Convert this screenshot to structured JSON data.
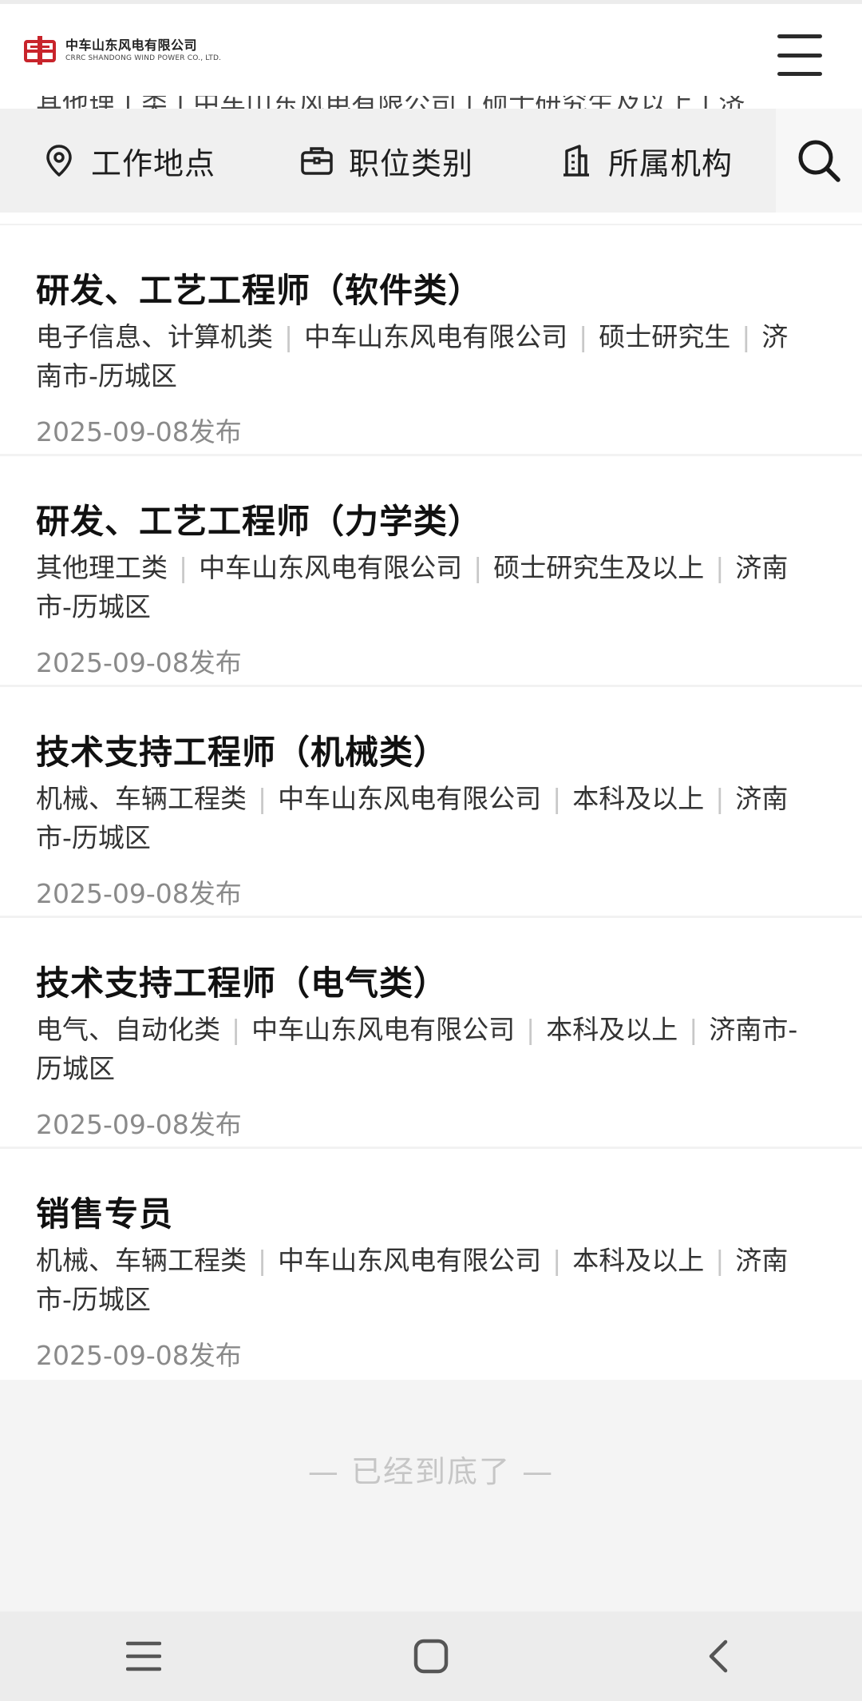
{
  "header": {
    "logo_cn": "中车山东风电有限公司",
    "logo_en": "CRRC SHANDONG WIND POWER CO., LTD."
  },
  "peek_text": "其他理工类  |  中车山东风电有限公司  |  硕士研究生及以上  |  济",
  "filters": [
    {
      "label": "工作地点",
      "icon": "location-pin-icon"
    },
    {
      "label": "职位类别",
      "icon": "briefcase-icon"
    },
    {
      "label": "所属机构",
      "icon": "building-icon"
    }
  ],
  "jobs": [
    {
      "title": "研发、工艺工程师（软件类）",
      "category": "电子信息、计算机类",
      "company": "中车山东风电有限公司",
      "education": "硕士研究生",
      "location": "济南市-历城区",
      "date": "2025-09-08发布"
    },
    {
      "title": "研发、工艺工程师（力学类）",
      "category": "其他理工类",
      "company": "中车山东风电有限公司",
      "education": "硕士研究生及以上",
      "location": "济南市-历城区",
      "date": "2025-09-08发布"
    },
    {
      "title": "技术支持工程师（机械类）",
      "category": "机械、车辆工程类",
      "company": "中车山东风电有限公司",
      "education": "本科及以上",
      "location": "济南市-历城区",
      "date": "2025-09-08发布"
    },
    {
      "title": "技术支持工程师（电气类）",
      "category": "电气、自动化类",
      "company": "中车山东风电有限公司",
      "education": "本科及以上",
      "location": "济南市-历城区",
      "date": "2025-09-08发布"
    },
    {
      "title": "销售专员",
      "category": "机械、车辆工程类",
      "company": "中车山东风电有限公司",
      "education": "本科及以上",
      "location": "济南市-历城区",
      "date": "2025-09-08发布"
    }
  ],
  "end_message": "— 已经到底了 —",
  "colors": {
    "brand_red": "#c8242b",
    "filter_bg": "#f0f0f0",
    "date_gray": "#8a8a8a"
  }
}
